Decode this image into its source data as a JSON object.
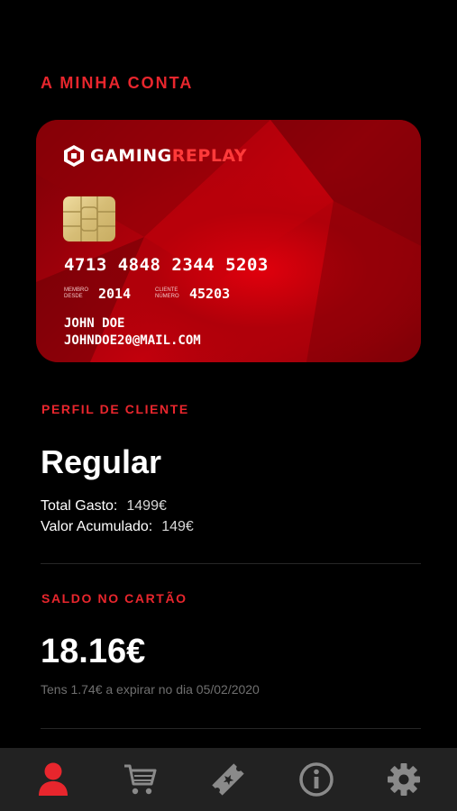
{
  "header": {
    "title": "A MINHA CONTA"
  },
  "card": {
    "brand_part1": "GAMING",
    "brand_part2": "REPLAY",
    "number": "4713 4848 2344 5203",
    "member_since_label": "MEMBRO DESDE",
    "member_since_value": "2014",
    "client_number_label": "CLIENTE NÚMERO",
    "client_number_value": "45203",
    "holder_name": "JOHN DOE",
    "holder_email": "JOHNDOE20@MAIL.COM"
  },
  "profile": {
    "section_label": "PERFIL DE CLIENTE",
    "tier": "Regular",
    "total_spent_label": "Total Gasto:",
    "total_spent_value": "1499€",
    "accumulated_label": "Valor Acumulado:",
    "accumulated_value": "149€"
  },
  "balance": {
    "section_label": "SALDO NO CARTÃO",
    "amount": "18.16€",
    "expiry_note": "Tens 1.74€ a expirar no dia 05/02/2020"
  },
  "tabbar": {
    "items": [
      {
        "icon": "user-icon",
        "active": true
      },
      {
        "icon": "cart-icon",
        "active": false
      },
      {
        "icon": "ticket-icon",
        "active": false
      },
      {
        "icon": "info-icon",
        "active": false
      },
      {
        "icon": "gear-icon",
        "active": false
      }
    ]
  },
  "colors": {
    "accent": "#e8262d",
    "inactive_icon": "#8a8a8a",
    "tabbar_bg": "#222222",
    "background": "#000000"
  }
}
